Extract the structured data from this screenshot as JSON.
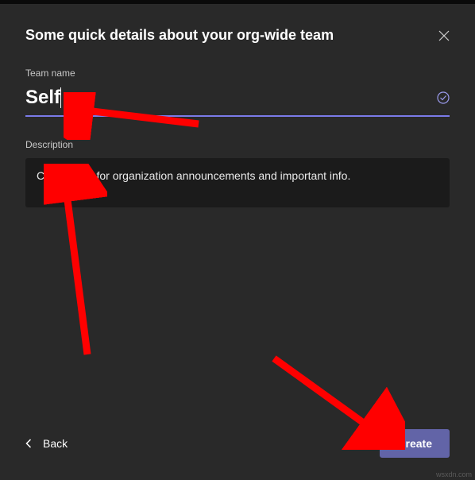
{
  "dialog": {
    "title": "Some quick details about your org-wide team"
  },
  "fields": {
    "team_name": {
      "label": "Team name",
      "value": "Self"
    },
    "description": {
      "label": "Description",
      "value": "Check here for organization announcements and important info."
    }
  },
  "footer": {
    "back_label": "Back",
    "create_label": "Create"
  },
  "watermark": "wsxdn.com",
  "annotations": {
    "arrows": [
      {
        "target": "team-name-input"
      },
      {
        "target": "description-box"
      },
      {
        "target": "create-button"
      }
    ]
  }
}
